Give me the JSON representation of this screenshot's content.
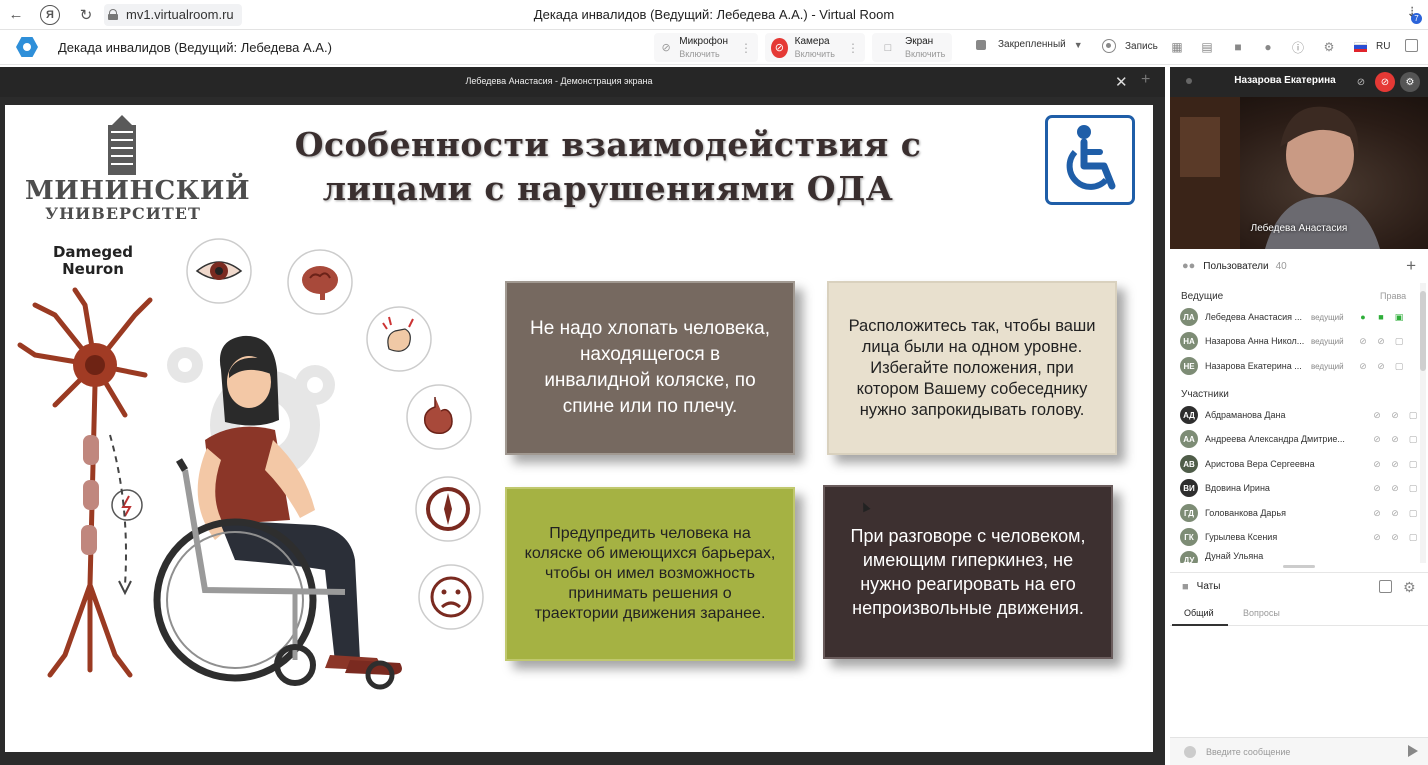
{
  "browser": {
    "url": "mv1.virtualroom.ru",
    "window_title": "Декада инвалидов (Ведущий: Лебедева А.А.) - Virtual Room",
    "download_badge": "7",
    "ya_glyph": "Я"
  },
  "toolbar": {
    "room_title": "Декада инвалидов (Ведущий: Лебедева А.А.)",
    "mic_label": "Микрофон",
    "mic_sub": "Включить",
    "camera_label": "Камера",
    "camera_sub": "Включить",
    "screen_label": "Экран",
    "screen_sub": "Включить",
    "pinned_label": "Закрепленный",
    "record_label": "Запись",
    "lang": "RU"
  },
  "share": {
    "title": "Лебедева Анастасия - Демонстрация экрана"
  },
  "slide": {
    "title_line1": "Особенности взаимодействия с",
    "title_line2": "лицами с нарушениями ОДА",
    "uni_line1": "МИНИНСКИЙ",
    "uni_line2": "УНИВЕРСИТЕТ",
    "neuron_line1": "Dameged",
    "neuron_line2": "Neuron",
    "cards": [
      {
        "lines": [
          "Не надо хлопать человека,",
          "находящегося в",
          "инвалидной коляске, по",
          "спине или по плечу."
        ]
      },
      {
        "lines": [
          "Расположитесь так, чтобы ваши",
          "лица были на одном уровне.",
          "Избегайте положения, при",
          "котором Вашему собеседнику",
          "нужно запрокидывать голову."
        ]
      },
      {
        "lines": [
          "Предупредить человека на",
          "коляске об имеющихся барьерах,",
          "чтобы он имел возможность",
          "принимать решения о",
          "траектории движения заранее."
        ]
      },
      {
        "lines": [
          "При разговоре с человеком,",
          "имеющим гиперкинез, не",
          "нужно реагировать на его",
          "непроизвольные движения."
        ]
      }
    ]
  },
  "video": {
    "header_name": "Назарова Екатерина",
    "caption": "Лебедева Анастасия"
  },
  "users": {
    "label": "Пользователи",
    "count": "40",
    "hosts_label": "Ведущие",
    "rights_label": "Права",
    "participants_label": "Участники",
    "hosts": [
      {
        "initials": "ЛА",
        "name": "Лебедева Анастасия ...",
        "role": "ведущий",
        "active": true
      },
      {
        "initials": "НА",
        "name": "Назарова Анна Никол...",
        "role": "ведущий",
        "active": false
      },
      {
        "initials": "НЕ",
        "name": "Назарова Екатерина ...",
        "role": "ведущий",
        "active": false
      }
    ],
    "participants": [
      {
        "initials": "АД",
        "name": "Абдраманова Дана",
        "color": "#2e2e2e"
      },
      {
        "initials": "АА",
        "name": "Андреева Александра Дмитрие...",
        "color": "#7d8c75"
      },
      {
        "initials": "АВ",
        "name": "Аристова Вера Сергеевна",
        "color": "#4f5d49"
      },
      {
        "initials": "ВИ",
        "name": "Вдовина Ирина",
        "color": "#2e2e2e"
      },
      {
        "initials": "ГД",
        "name": "Голованкова Дарья",
        "color": "#7d8c75"
      },
      {
        "initials": "ГК",
        "name": "Гурылева Ксения",
        "color": "#7d8c75"
      },
      {
        "initials": "ДУ",
        "name": "Дунай Ульяна",
        "color": "#7d8c75"
      }
    ]
  },
  "chats": {
    "label": "Чаты",
    "tab_general": "Общий",
    "tab_questions": "Вопросы",
    "input_placeholder": "Введите сообщение"
  }
}
